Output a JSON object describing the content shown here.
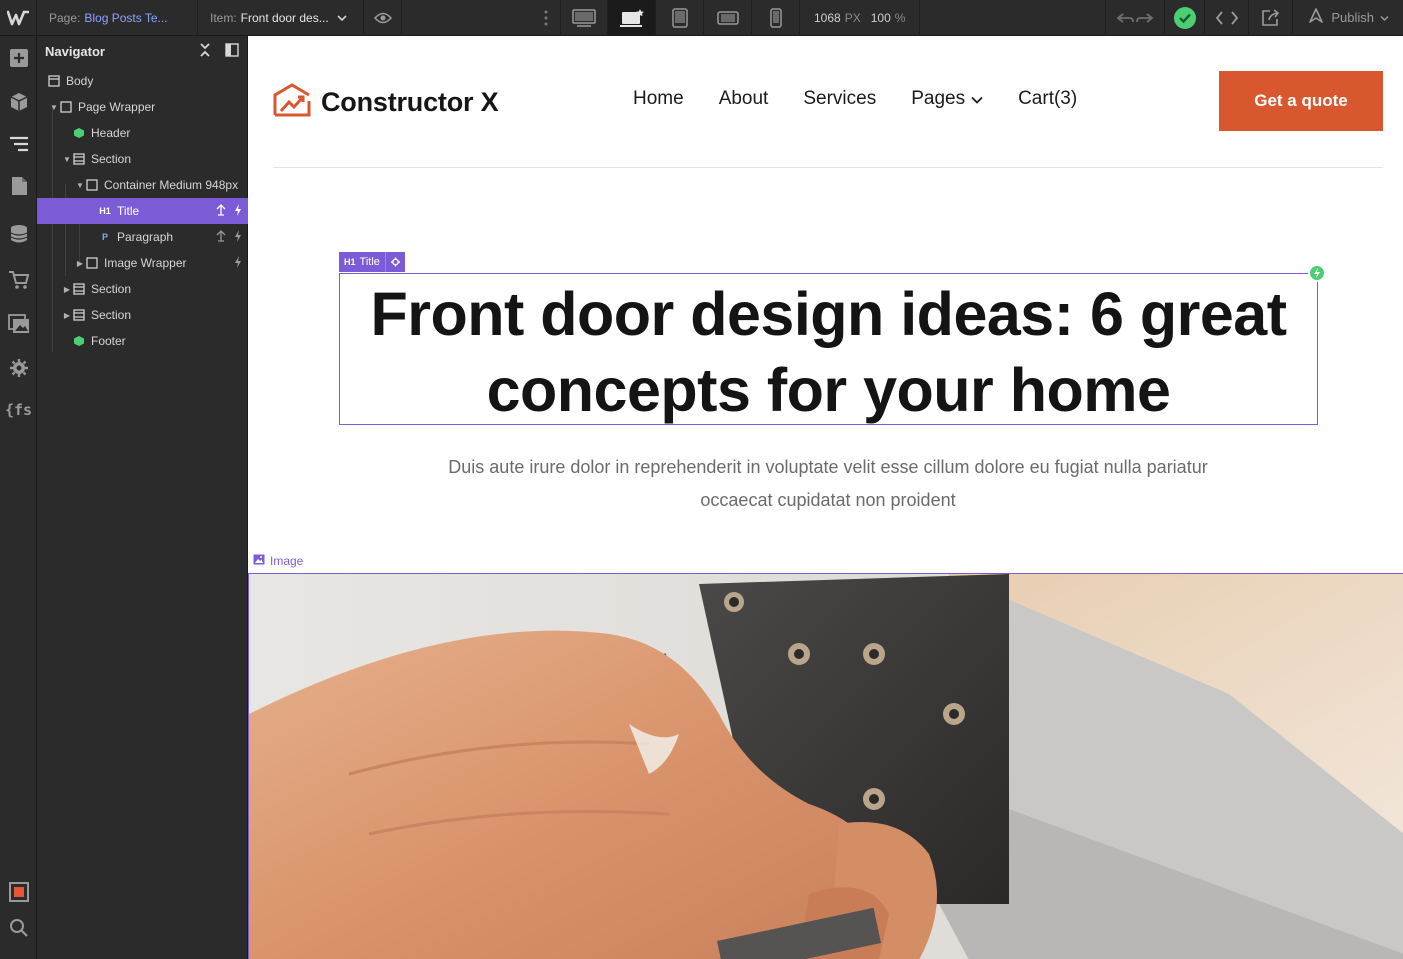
{
  "topbar": {
    "page_label": "Page:",
    "page_value": "Blog Posts Te...",
    "item_label": "Item:",
    "item_value": "Front door des...",
    "width_value": "1068",
    "width_unit": "PX",
    "zoom_value": "100",
    "zoom_unit": "%",
    "publish_label": "Publish"
  },
  "navigator": {
    "title": "Navigator",
    "tree": [
      {
        "label": "Body"
      },
      {
        "label": "Page Wrapper"
      },
      {
        "label": "Header"
      },
      {
        "label": "Section"
      },
      {
        "label": "Container Medium 948px"
      },
      {
        "label": "Title",
        "tag": "H1"
      },
      {
        "label": "Paragraph",
        "tag": "P"
      },
      {
        "label": "Image Wrapper"
      },
      {
        "label": "Section"
      },
      {
        "label": "Section"
      },
      {
        "label": "Footer"
      }
    ]
  },
  "site": {
    "brand": "Constructor X",
    "menu": [
      "Home",
      "About",
      "Services",
      "Pages",
      "Cart(3)"
    ],
    "cta": "Get a quote",
    "selection_tag": "Title",
    "selection_tag_prefix": "H1",
    "headline": "Front door design ideas: 6 great concepts for your home",
    "paragraph": "Duis aute irure dolor in reprehenderit in voluptate velit esse cillum dolore eu fugiat nulla pariatur occaecat cupidatat non proident",
    "image_label": "Image"
  },
  "colors": {
    "accent": "#7c5cd6",
    "cta": "#d9572f",
    "status_green": "#4ccf74"
  }
}
